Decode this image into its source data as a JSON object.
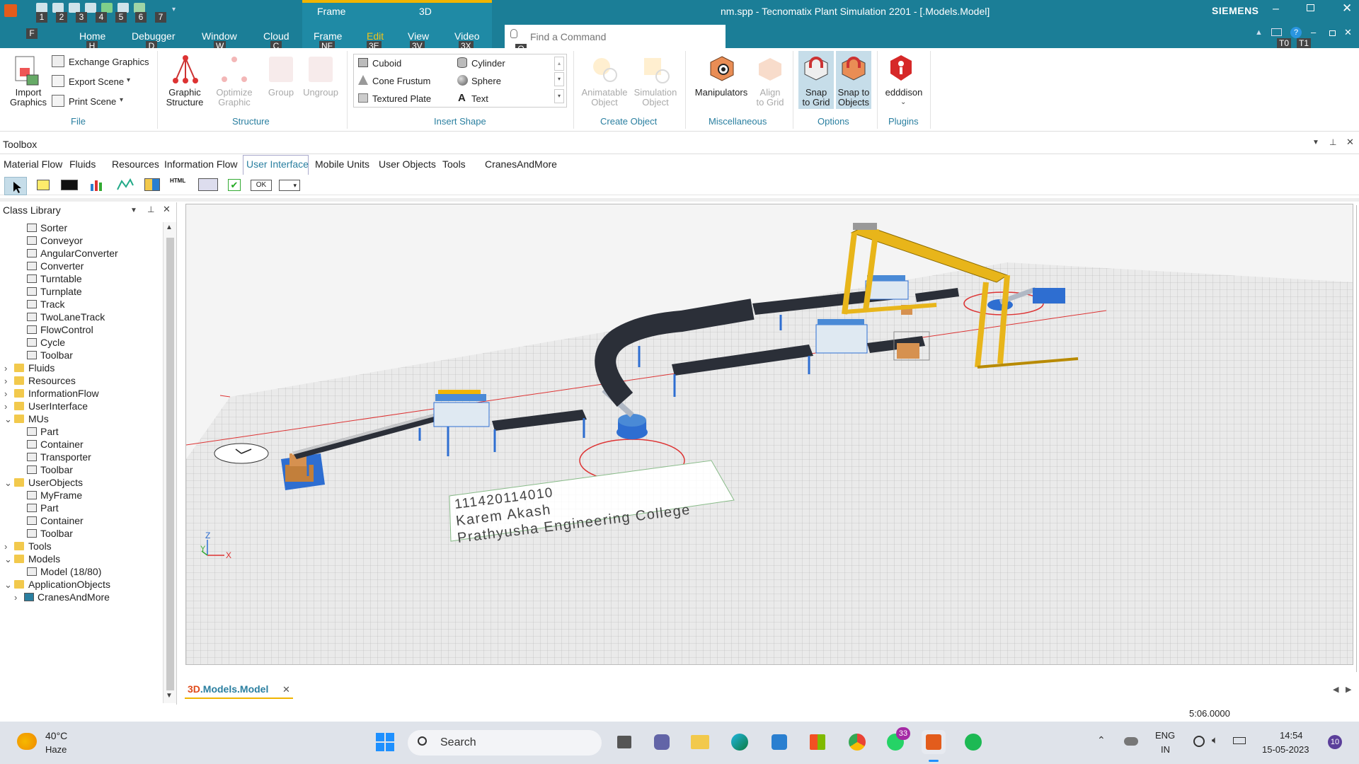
{
  "window": {
    "app_icon": "plant-simulation-icon",
    "title": "nm.spp - Tecnomatix Plant Simulation 2201 - [.Models.Model]",
    "brand": "SIEMENS",
    "context_tabs": [
      "Frame",
      "3D"
    ],
    "search_placeholder": "Find a Command",
    "search_keytip": "Q",
    "right_keytips": [
      "T0",
      "T1"
    ]
  },
  "qat": {
    "keytips": [
      "1",
      "2",
      "3",
      "4",
      "5",
      "6",
      "7"
    ],
    "file_keytip": "F"
  },
  "menu": {
    "tabs": [
      {
        "label": "Home",
        "keytip": "H"
      },
      {
        "label": "Debugger",
        "keytip": "D"
      },
      {
        "label": "Window",
        "keytip": "W"
      },
      {
        "label": "Cloud",
        "keytip": "C"
      },
      {
        "label": "Frame",
        "keytip": "NF"
      },
      {
        "label": "Edit",
        "keytip": "3E"
      },
      {
        "label": "View",
        "keytip": "3V"
      },
      {
        "label": "Video",
        "keytip": "3X"
      }
    ]
  },
  "ribbon": {
    "file": {
      "import_graphics": "Import\nGraphics",
      "exchange_graphics": "Exchange Graphics",
      "export_scene": "Export Scene",
      "print_scene": "Print Scene",
      "group_label": "File"
    },
    "structure": {
      "graphic_structure": "Graphic\nStructure",
      "optimize_graphic": "Optimize\nGraphic",
      "group": "Group",
      "ungroup": "Ungroup",
      "group_label": "Structure"
    },
    "insert_shape": {
      "items": [
        "Cuboid",
        "Cylinder",
        "Cone Frustum",
        "Sphere",
        "Textured Plate",
        "Text"
      ],
      "group_label": "Insert Shape"
    },
    "create_object": {
      "animatable": "Animatable\nObject",
      "simulation": "Simulation\nObject",
      "group_label": "Create Object"
    },
    "misc": {
      "manipulators": "Manipulators",
      "align": "Align\nto Grid",
      "group_label": "Miscellaneous"
    },
    "options": {
      "snap_grid": "Snap\nto Grid",
      "snap_objects": "Snap to\nObjects",
      "group_label": "Options"
    },
    "plugins": {
      "edddison": "edddison",
      "group_label": "Plugins"
    }
  },
  "toolbox": {
    "title": "Toolbox",
    "tabs": [
      "Material Flow",
      "Fluids",
      "Resources",
      "Information Flow",
      "User Interface",
      "Mobile Units",
      "User Objects",
      "Tools",
      "CranesAndMore"
    ],
    "active_tab": "User Interface",
    "ok_label": "OK"
  },
  "class_library": {
    "title": "Class Library",
    "items": [
      {
        "label": "Sorter",
        "icon": "sorter-icon",
        "level": 2
      },
      {
        "label": "Conveyor",
        "icon": "conveyor-icon",
        "level": 2
      },
      {
        "label": "AngularConverter",
        "icon": "angular-converter-icon",
        "level": 2
      },
      {
        "label": "Converter",
        "icon": "converter-icon",
        "level": 2
      },
      {
        "label": "Turntable",
        "icon": "turntable-icon",
        "level": 2
      },
      {
        "label": "Turnplate",
        "icon": "turnplate-icon",
        "level": 2
      },
      {
        "label": "Track",
        "icon": "track-icon",
        "level": 2
      },
      {
        "label": "TwoLaneTrack",
        "icon": "two-lane-track-icon",
        "level": 2
      },
      {
        "label": "FlowControl",
        "icon": "flow-control-icon",
        "level": 2
      },
      {
        "label": "Cycle",
        "icon": "cycle-icon",
        "level": 2
      },
      {
        "label": "Toolbar",
        "icon": "toolbar-icon",
        "level": 2
      },
      {
        "label": "Fluids",
        "icon": "folder-icon",
        "level": 1,
        "expander": "collapsed"
      },
      {
        "label": "Resources",
        "icon": "folder-icon",
        "level": 1,
        "expander": "collapsed"
      },
      {
        "label": "InformationFlow",
        "icon": "folder-icon",
        "level": 1,
        "expander": "collapsed"
      },
      {
        "label": "UserInterface",
        "icon": "folder-icon",
        "level": 1,
        "expander": "collapsed"
      },
      {
        "label": "MUs",
        "icon": "folder-icon",
        "level": 1,
        "expander": "expanded"
      },
      {
        "label": "Part",
        "icon": "part-icon",
        "level": 2
      },
      {
        "label": "Container",
        "icon": "container-icon",
        "level": 2
      },
      {
        "label": "Transporter",
        "icon": "transporter-icon",
        "level": 2
      },
      {
        "label": "Toolbar",
        "icon": "toolbar-icon",
        "level": 2
      },
      {
        "label": "UserObjects",
        "icon": "folder-icon",
        "level": 1,
        "expander": "expanded"
      },
      {
        "label": "MyFrame",
        "icon": "frame-icon",
        "level": 2
      },
      {
        "label": "Part",
        "icon": "part-icon",
        "level": 2
      },
      {
        "label": "Container",
        "icon": "container-icon",
        "level": 2
      },
      {
        "label": "Toolbar",
        "icon": "toolbar-icon",
        "level": 2
      },
      {
        "label": "Tools",
        "icon": "folder-icon",
        "level": 1,
        "expander": "collapsed"
      },
      {
        "label": "Models",
        "icon": "folder-icon",
        "level": 1,
        "expander": "expanded"
      },
      {
        "label": "Model (18/80)",
        "icon": "frame-icon",
        "level": 2
      },
      {
        "label": "ApplicationObjects",
        "icon": "folder-icon",
        "level": 1,
        "expander": "expanded"
      },
      {
        "label": "CranesAndMore",
        "icon": "cube-icon",
        "level": 2,
        "expander": "collapsed"
      }
    ]
  },
  "scene": {
    "sign_lines": [
      "111420114010",
      "Karem Akash",
      "Prathyusha Engineering College"
    ],
    "axis_z": "Z",
    "axis_y": "Y",
    "axis_x": "X"
  },
  "doc_tab": {
    "prefix": "3D",
    "label": ".Models.Model"
  },
  "status": {
    "sim_time": "5:06.0000"
  },
  "taskbar": {
    "weather_temp": "40°C",
    "weather_desc": "Haze",
    "search_label": "Search",
    "whatsapp_badge": "33",
    "lang": "ENG",
    "region": "IN",
    "time": "14:54",
    "date": "15-05-2023",
    "notif_count": "10"
  },
  "colors": {
    "titlebar": "#1b7e97",
    "accent": "#2a7fa0",
    "conveyor": "#2b2f38",
    "crane": "#e8b51a"
  }
}
